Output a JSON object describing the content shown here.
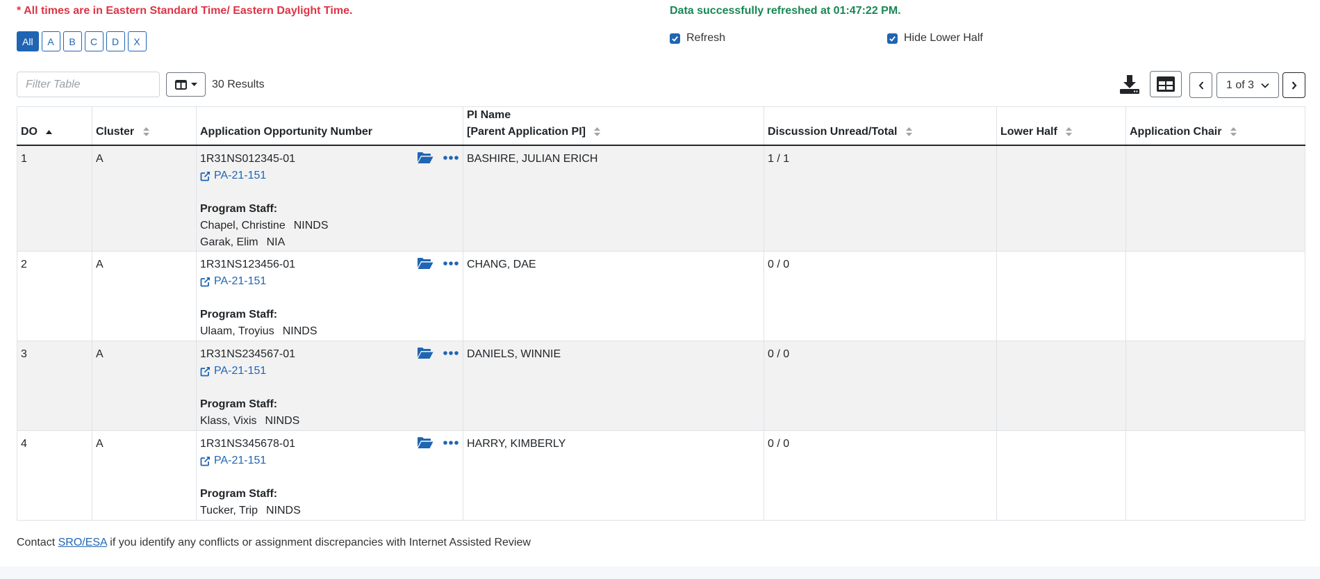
{
  "notice": {
    "timezone_warning": "* All times are in Eastern Standard Time/ Eastern Daylight Time.",
    "refreshed_message": "Data successfully refreshed at 01:47:22 PM."
  },
  "cluster_filter": {
    "options": [
      "All",
      "A",
      "B",
      "C",
      "D",
      "X"
    ],
    "selected": "All"
  },
  "toggles": {
    "refresh": {
      "label": "Refresh",
      "checked": true
    },
    "hide_lower_half": {
      "label": "Hide Lower Half",
      "checked": true
    }
  },
  "toolbar": {
    "filter_placeholder": "Filter Table",
    "results_text": "30 Results",
    "page_select": "1 of 3"
  },
  "table": {
    "columns": {
      "do": "DO",
      "cluster": "Cluster",
      "app": "Application Opportunity Number",
      "pi_line1": "PI Name",
      "pi_line2": "[Parent Application PI]",
      "discussion": "Discussion Unread/Total",
      "lower_half": "Lower Half",
      "chair": "Application Chair"
    },
    "sorted_column": "DO",
    "program_staff_label": "Program Staff:",
    "rows": [
      {
        "do": "1",
        "cluster": "A",
        "app_number": "1R31NS012345-01",
        "funding_link": "PA-21-151",
        "staff": [
          {
            "name": "Chapel, Christine",
            "ic": "NINDS"
          },
          {
            "name": "Garak, Elim",
            "ic": "NIA"
          }
        ],
        "pi": "BASHIRE, JULIAN ERICH",
        "discussion": "1 / 1",
        "lower_half": "",
        "chair": ""
      },
      {
        "do": "2",
        "cluster": "A",
        "app_number": "1R31NS123456-01",
        "funding_link": "PA-21-151",
        "staff": [
          {
            "name": "Ulaam, Troyius",
            "ic": "NINDS"
          }
        ],
        "pi": "CHANG, DAE",
        "discussion": "0 / 0",
        "lower_half": "",
        "chair": ""
      },
      {
        "do": "3",
        "cluster": "A",
        "app_number": "1R31NS234567-01",
        "funding_link": "PA-21-151",
        "staff": [
          {
            "name": "Klass, Vixis",
            "ic": "NINDS"
          }
        ],
        "pi": "DANIELS, WINNIE",
        "discussion": "0 / 0",
        "lower_half": "",
        "chair": ""
      },
      {
        "do": "4",
        "cluster": "A",
        "app_number": "1R31NS345678-01",
        "funding_link": "PA-21-151",
        "staff": [
          {
            "name": "Tucker, Trip",
            "ic": "NINDS"
          }
        ],
        "pi": "HARRY, KIMBERLY",
        "discussion": "0 / 0",
        "lower_half": "",
        "chair": ""
      }
    ]
  },
  "footer": {
    "prefix": "Contact",
    "link_text": "SRO/ESA",
    "suffix": "if you identify any conflicts or assignment discrepancies with Internet Assisted Review"
  },
  "colors": {
    "primary": "#1f65b3",
    "warning": "#dc3545",
    "success": "#198754",
    "row_stripe": "#f2f2f2"
  },
  "icons": [
    "check-icon",
    "columns-icon",
    "caret-down-icon",
    "download-icon",
    "table-view-icon",
    "chevron-left-icon",
    "chevron-down-icon",
    "chevron-right-icon",
    "sort-icon",
    "folder-open-icon",
    "ellipsis-icon",
    "external-link-icon"
  ]
}
